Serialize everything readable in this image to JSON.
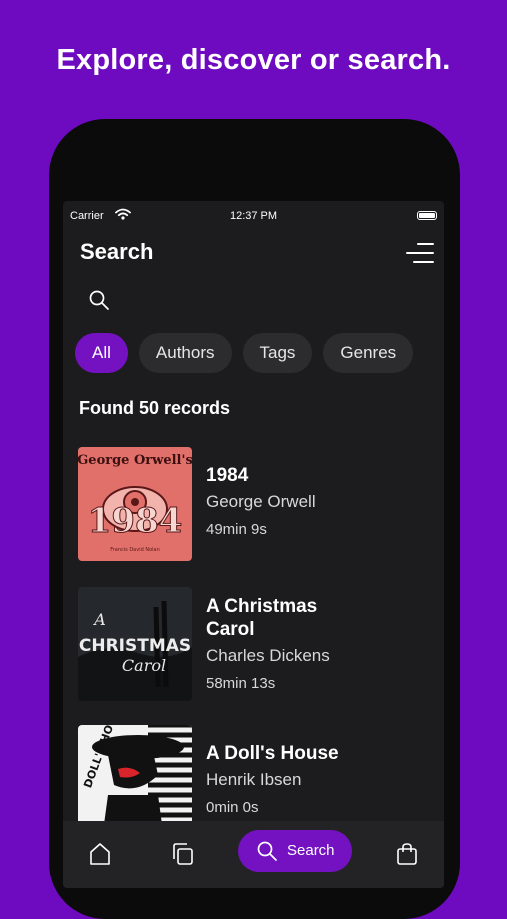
{
  "headline": "Explore, discover or search.",
  "status_bar": {
    "carrier": "Carrier",
    "time": "12:37 PM"
  },
  "header": {
    "title": "Search"
  },
  "filters": [
    {
      "label": "All",
      "active": true
    },
    {
      "label": "Authors",
      "active": false
    },
    {
      "label": "Tags",
      "active": false
    },
    {
      "label": "Genres",
      "active": false
    }
  ],
  "results": {
    "summary": "Found 50 records",
    "items": [
      {
        "title": "1984",
        "author": "George Orwell",
        "duration": "49min 9s",
        "cover_text": [
          "George Orwell's",
          "1984",
          "Francis David Nolan"
        ]
      },
      {
        "title": "A Christmas Carol",
        "author": "Charles Dickens",
        "duration": "58min 13s",
        "cover_text": [
          "A",
          "CHRISTMAS",
          "Carol"
        ]
      },
      {
        "title": "A Doll's House",
        "author": "Henrik Ibsen",
        "duration": "0min 0s",
        "cover_text": [
          "DOLL'S HOUSE"
        ]
      }
    ]
  },
  "tab_bar": {
    "items": [
      "home-icon",
      "library-icon",
      "search-icon",
      "bag-icon"
    ],
    "active_label": "Search"
  },
  "colors": {
    "background": "#6e0bc0",
    "accent": "#7412c2",
    "screen": "#1c1c1e"
  }
}
